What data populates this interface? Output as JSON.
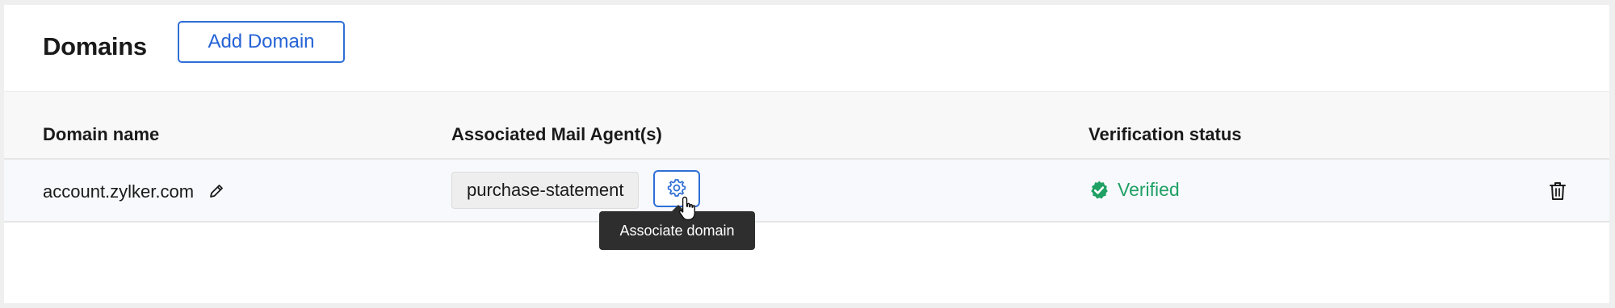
{
  "header": {
    "title": "Domains",
    "add_button_label": "Add Domain"
  },
  "table": {
    "columns": [
      "Domain name",
      "Associated Mail Agent(s)",
      "Verification status"
    ],
    "rows": [
      {
        "domain": "account.zylker.com",
        "mail_agent": "purchase-statement",
        "status": "Verified"
      }
    ]
  },
  "tooltip": {
    "text": "Associate domain"
  },
  "colors": {
    "accent_blue": "#2563d6",
    "verified_green": "#1fa064",
    "tooltip_bg": "#2e2e2e"
  },
  "icons": {
    "edit": "pencil-icon",
    "associate": "gear-icon",
    "verified": "check-badge-icon",
    "delete": "trash-icon",
    "cursor": "hand-pointer-icon"
  }
}
